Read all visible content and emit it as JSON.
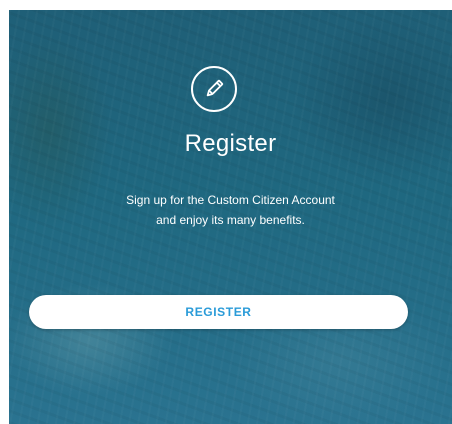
{
  "register_card": {
    "icon": "pencil-icon",
    "title": "Register",
    "subtitle_line1": "Sign up for the Custom Citizen Account",
    "subtitle_line2": "and enjoy its many benefits.",
    "button_label": "REGISTER"
  },
  "colors": {
    "background": "#1f6880",
    "button_bg": "#ffffff",
    "button_text": "#2a9bd8",
    "text": "#ffffff"
  }
}
